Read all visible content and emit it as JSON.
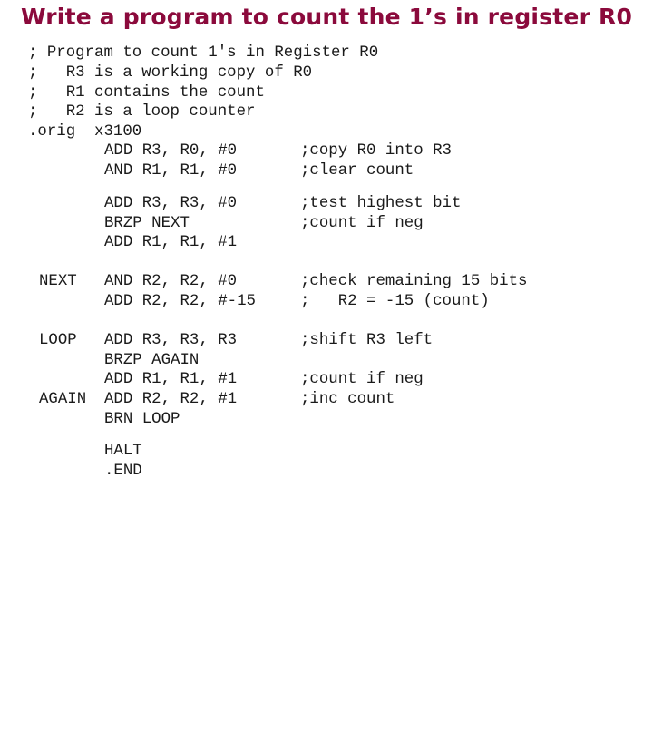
{
  "title": "Write a program to count the 1’s in register R0",
  "header_comments": [
    "; Program to count 1's in Register R0",
    ";   R3 is a working copy of R0",
    ";   R1 contains the count",
    ";   R2 is a loop counter",
    ".orig  x3100"
  ],
  "code_lines": [
    {
      "label": "",
      "instr": "ADD R3, R0, #0",
      "comment": ";copy R0 into R3"
    },
    {
      "label": "",
      "instr": "AND R1, R1, #0",
      "comment": ";clear count"
    },
    {
      "label": "",
      "instr": "ADD R3, R3, #0",
      "comment": ";test highest bit"
    },
    {
      "label": "",
      "instr": "BRZP NEXT",
      "comment": ";count if neg"
    },
    {
      "label": "",
      "instr": "ADD R1, R1, #1",
      "comment": ""
    },
    {
      "label": "NEXT",
      "instr": "AND R2, R2, #0",
      "comment": ";check remaining 15 bits"
    },
    {
      "label": "",
      "instr": "ADD R2, R2, #-15",
      "comment": ";   R2 = -15 (count)"
    },
    {
      "label": "LOOP",
      "instr": "ADD R3, R3, R3",
      "comment": ";shift R3 left"
    },
    {
      "label": "",
      "instr": "BRZP AGAIN",
      "comment": ""
    },
    {
      "label": "",
      "instr": "ADD R1, R1, #1",
      "comment": ";count if neg"
    },
    {
      "label": "AGAIN",
      "instr": "ADD R2, R2, #1",
      "comment": ";inc count"
    },
    {
      "label": "",
      "instr": "BRN LOOP",
      "comment": ""
    },
    {
      "label": "",
      "instr": "HALT",
      "comment": ""
    },
    {
      "label": "",
      "instr": ".END",
      "comment": ""
    }
  ]
}
